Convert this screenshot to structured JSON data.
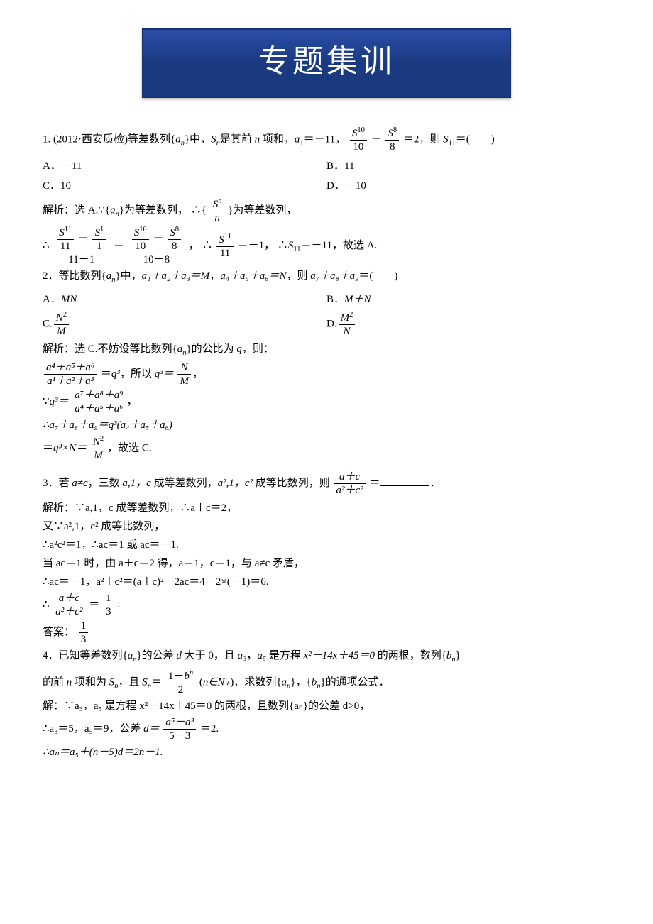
{
  "banner": "专题集训",
  "q1": {
    "prefix": "1. (2012·西安质检)等差数列{",
    "an": "a",
    "n": "n",
    "mid1": "}中，",
    "Sn": "S",
    "mid2": "是其前 ",
    "nword": "n",
    "mid3": " 项和，",
    "a1": "a",
    "eq1": "＝－11，",
    "frac1num": "S",
    "frac1numsup": "10",
    "frac1den": "10",
    "minus": "－",
    "frac2num": "S",
    "frac2numsup": "8",
    "frac2den": "8",
    "eq2": "＝2，则 ",
    "S11": "S",
    "tail": "＝(　　)",
    "choiceA": "A．－11",
    "choiceB": "B．11",
    "choiceC": "C．10",
    "choiceD": "D．－10",
    "sol_prefix": "解析：选 A.∵{",
    "sol_mid1": "}为等差数列，  ∴{",
    "sol_frac_num": "S",
    "sol_frac_numsup": "n",
    "sol_frac_den": "n",
    "sol_tail1": "}为等差数列，",
    "sol_line2_a": "∴",
    "sol_f1n_a": "S",
    "sol_f1n_a_sup": "11",
    "sol_f1n_b": "11",
    "sol_f2n_a": "S",
    "sol_f2n_a_sup": "1",
    "sol_f2n_b": "1",
    "sol_den1": "11－1",
    "sol_eq": "＝",
    "sol_f3n_a": "S",
    "sol_f3n_a_sup": "10",
    "sol_f3n_b": "10",
    "sol_f4n_a": "S",
    "sol_f4n_a_sup": "8",
    "sol_f4n_b": "8",
    "sol_den2": "10－8",
    "sol_mid2": "，  ∴",
    "sol_f5num": "S",
    "sol_f5numsup": "11",
    "sol_f5den": "11",
    "sol_mid3": "＝－1，  ∴",
    "sol_S11": "S",
    "sol_tail2": "＝－11，故选 A."
  },
  "q2": {
    "prefix": "2．等比数列{",
    "an": "a",
    "n": "n",
    "mid1": "}中，",
    "part1": "a₁＋a₂＋a₃＝M",
    "comma1": "，",
    "part2": "a₄＋a₅＋a₆＝N",
    "comma2": "，则 ",
    "part3": "a₇＋a₈＋a₉",
    "tail": "＝(　　)",
    "choiceA": "A．",
    "choiceA_val": "MN",
    "choiceB": "B．",
    "choiceB_val": "M＋N",
    "choiceC": "C.",
    "choiceC_num": "N",
    "choiceC_numsup": "2",
    "choiceC_den": "M",
    "choiceD": "D.",
    "choiceD_num": "M",
    "choiceD_numsup": "2",
    "choiceD_den": "N",
    "sol_prefix": "解析：选 C.不妨设等比数列{",
    "sol_mid1": "}的公比为 ",
    "q": "q",
    "sol_tail1": "，则：",
    "sol_l2_num": "a⁴＋a⁵＋a⁶",
    "sol_l2_den": "a¹＋a²＋a³",
    "sol_l2_eq": "＝",
    "sol_l2_q3": "q³",
    "sol_l2_mid": "，所以 ",
    "sol_l2_q3b": "q³＝",
    "sol_l2_frnum": "N",
    "sol_l2_frden": "M",
    "sol_l2_tail": "，",
    "sol_l3_pre": "∵",
    "sol_l3_q3": "q³＝",
    "sol_l3_num": "a⁷＋a⁸＋a⁹",
    "sol_l3_den": "a⁴＋a⁵＋a⁶",
    "sol_l3_tail": "，",
    "sol_l4": "∴a₇＋a₈＋a₉＝q³(a₄＋a₅＋a₆)",
    "sol_l5_pre": "＝",
    "sol_l5_q3N": "q³×N＝",
    "sol_l5_num": "N",
    "sol_l5_numsup": "2",
    "sol_l5_den": "M",
    "sol_l5_tail": "，故选 C."
  },
  "q3": {
    "prefix": "3．若 ",
    "cond1": "a≠c",
    "mid1": "，三数 ",
    "cond2": "a,1，c",
    "mid2": " 成等差数列，",
    "cond3": "a²,1，c²",
    "mid3": " 成等比数列，则",
    "frac_num": "a＋c",
    "frac_den": "a²＋c²",
    "eq": "＝",
    "tail": "．",
    "sol_l1": "解析：∵a,1，c 成等差数列，∴a＋c＝2，",
    "sol_l2": "又∵a²,1，c² 成等比数列，",
    "sol_l3": "∴a²c²＝1，∴ac＝1 或 ac＝－1.",
    "sol_l4": "当 ac＝1 时，由 a＋c＝2 得，a＝1，c＝1，与 a≠c 矛盾，",
    "sol_l5": "∴ac＝－1，a²＋c²＝(a＋c)²－2ac＝4－2×(－1)＝6.",
    "sol_l6_pre": "∴",
    "sol_l6_num": "a＋c",
    "sol_l6_den": "a²＋c²",
    "sol_l6_eq": "＝",
    "sol_l6_rnum": "1",
    "sol_l6_rden": "3",
    "sol_l6_tail": ".",
    "ans_pre": "答案：",
    "ans_num": "1",
    "ans_den": "3"
  },
  "q4": {
    "l1_pre": "4．已知等差数列{",
    "an": "a",
    "n": "n",
    "l1_mid": "}的公差 ",
    "d": "d",
    "l1_mid2": " 大于 0，且 ",
    "a3": "a₃",
    "comma": "，",
    "a5": "a₅",
    "l1_mid3": " 是方程 ",
    "eq": "x²－14x＋45＝0",
    "l1_tail": " 的两根，数列{",
    "bn": "b",
    "l1_tail2": "}",
    "l2_pre": "的前 ",
    "nword": "n",
    "l2_mid": " 项和为 ",
    "Sn": "S",
    "l2_mid2": "，且 ",
    "l2_Sn": "S",
    "l2_eq": "＝",
    "l2_num_pre": "1－",
    "l2_num_b": "b",
    "l2_num_sup": "n",
    "l2_den": "2",
    "l2_mid3": "(",
    "l2_nin": "n∈N₊",
    "l2_tail": ")．求数列{",
    "l2_tail2": "}，{",
    "l2_tail3": "}的通项公式．",
    "sol_l1": "解：∵a₃，a₅ 是方程 x²－14x＋45＝0 的两根，且数列{aₙ}的公差 d>0，",
    "sol_l2_pre": "∴a₃＝5，a₅＝9，公差 ",
    "sol_l2_d": "d＝",
    "sol_l2_num": "a⁵－a³",
    "sol_l2_den": "5－3",
    "sol_l2_tail": "＝2.",
    "sol_l3": "∴aₙ＝a₅＋(n－5)d＝2n－1."
  }
}
